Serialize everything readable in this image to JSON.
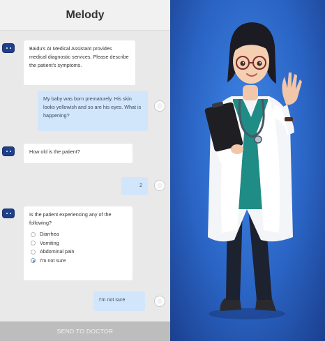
{
  "header": {
    "title": "Melody"
  },
  "messages": [
    {
      "sender": "bot",
      "text": "Baidu's AI Medical Assistant provides medical diagnostic services. Please describe the patient's symptoms."
    },
    {
      "sender": "user",
      "text": "My baby was born prematurely. His skin looks yellowish and so are his eyes. What is happening?"
    },
    {
      "sender": "bot",
      "text": "How old is the patient?"
    },
    {
      "sender": "user",
      "text": "2"
    },
    {
      "sender": "bot",
      "text": "Is the patient experiencing any of the following?"
    },
    {
      "sender": "user",
      "text": "I'm not sure"
    }
  ],
  "options": [
    {
      "label": "Diarrhea",
      "selected": false
    },
    {
      "label": "Vomiting",
      "selected": false
    },
    {
      "label": "Abdominal pain",
      "selected": false
    },
    {
      "label": "I'm not sure",
      "selected": true
    }
  ],
  "footer": {
    "send_label": "SEND TO DOCTOR"
  },
  "colors": {
    "bot_avatar": "#1f3f8a",
    "user_bubble": "#d2e6fb",
    "bot_bubble": "#ffffff",
    "send_button": "#bdbdbd",
    "illustration_bg": "#2a64c4"
  },
  "icons": {
    "bot_avatar": "robot-icon",
    "user_avatar": "user-avatar-icon"
  }
}
